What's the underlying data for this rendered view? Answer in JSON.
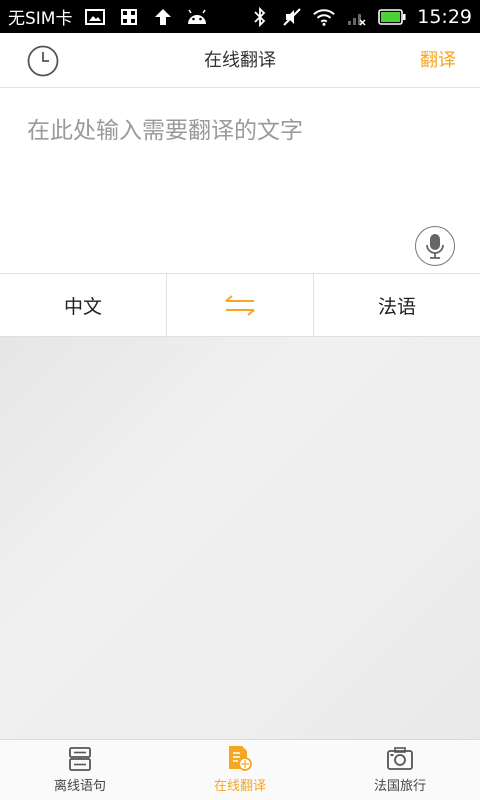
{
  "status_bar": {
    "carrier": "无SIM卡",
    "time": "15:29"
  },
  "header": {
    "title": "在线翻译",
    "action_label": "翻译"
  },
  "input": {
    "value": "",
    "placeholder": "在此处输入需要翻译的文字"
  },
  "languages": {
    "source": "中文",
    "target": "法语"
  },
  "tabs": [
    {
      "label": "离线语句",
      "icon": "phrasebook-icon",
      "active": false
    },
    {
      "label": "在线翻译",
      "icon": "online-translate-icon",
      "active": true
    },
    {
      "label": "法国旅行",
      "icon": "camera-icon",
      "active": false
    }
  ],
  "colors": {
    "accent": "#f5a623",
    "status_bar_bg": "#000000",
    "battery": "#4cd137"
  }
}
